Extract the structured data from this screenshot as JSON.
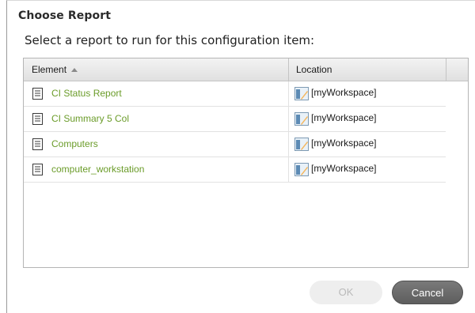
{
  "dialog": {
    "title": "Choose Report",
    "prompt": "Select a report to run for this configuration item:"
  },
  "table": {
    "columns": {
      "element": "Element",
      "location": "Location"
    },
    "sort": {
      "column": "element",
      "direction": "ascending"
    },
    "rows": [
      {
        "element": "CI Status Report",
        "location": "[myWorkspace]"
      },
      {
        "element": "CI Summary 5 Col",
        "location": "[myWorkspace]"
      },
      {
        "element": "Computers",
        "location": "[myWorkspace]"
      },
      {
        "element": "computer_workstation",
        "location": "[myWorkspace]"
      }
    ]
  },
  "buttons": {
    "ok": {
      "label": "OK",
      "enabled": false
    },
    "cancel": {
      "label": "Cancel",
      "enabled": true
    }
  },
  "colors": {
    "link": "#6b9c2a",
    "cancel_bg": "#6a6a6a",
    "ok_disabled_bg": "#eeeeee"
  },
  "icons": {
    "element": "document-icon",
    "location": "workspace-icon"
  }
}
